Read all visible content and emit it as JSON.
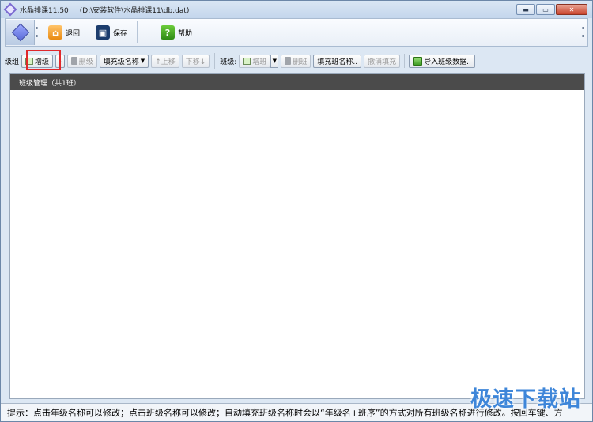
{
  "window": {
    "app_name": "水晶排课11.50",
    "file_path": "(D:\\安装软件\\水晶排课11\\db.dat)",
    "buttons": {
      "minimize": "▬",
      "maximize": "▭",
      "close": "✕"
    }
  },
  "ribbon": {
    "back_label": "退回",
    "save_label": "保存",
    "help_label": "帮助",
    "help_glyph": "?"
  },
  "grade_bar": {
    "section_label": "级组",
    "add_grade": "增级",
    "more": "..",
    "delete_grade": "删级",
    "fill_grade_name": "填充级名称",
    "move_up": "↑上移",
    "move_down": "下移↓"
  },
  "class_bar": {
    "section_label": "班级:",
    "add_class": "增班",
    "delete_class": "删班",
    "fill_class_name": "填充班名称..",
    "undo_fill": "撤消填充",
    "import_class_data": "导入班级数据.."
  },
  "panel": {
    "header": "班级管理（共1班）"
  },
  "status": {
    "hint": "提示：点击年级名称可以修改；点击班级名称可以修改；自动填充班级名称时会以“年级名+班序”的方式对所有班级名称进行修改。按回车键、方"
  },
  "watermark": "极速下载站",
  "colors": {
    "panel_header_bg": "#4b4b4b",
    "highlight_border": "#e0282c",
    "watermark": "#3e86d9"
  }
}
